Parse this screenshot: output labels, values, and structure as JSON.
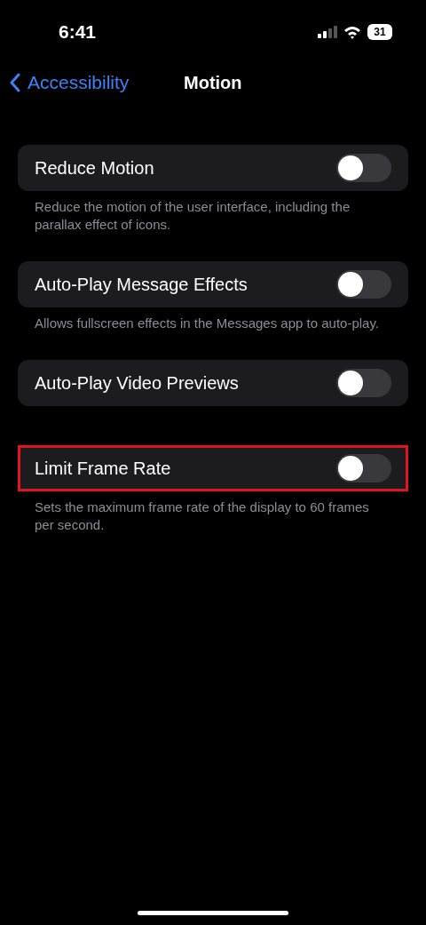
{
  "status_bar": {
    "time": "6:41",
    "battery": "31"
  },
  "nav": {
    "back": "Accessibility",
    "title": "Motion"
  },
  "groups": [
    {
      "label": "Reduce Motion",
      "on": false,
      "highlighted": false,
      "footer": "Reduce the motion of the user interface, including the parallax effect of icons."
    },
    {
      "label": "Auto-Play Message Effects",
      "on": false,
      "highlighted": false,
      "footer": "Allows fullscreen effects in the Messages app to auto-play."
    },
    {
      "label": "Auto-Play Video Previews",
      "on": false,
      "highlighted": false
    },
    {
      "label": "Limit Frame Rate",
      "on": false,
      "highlighted": true,
      "footer": "Sets the maximum frame rate of the display to 60 frames per second."
    }
  ]
}
